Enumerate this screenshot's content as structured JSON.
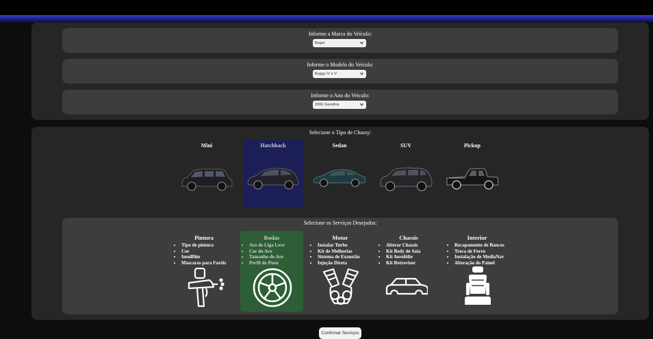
{
  "vehicle": {
    "brand": {
      "label": "Informe a Marca do Veículo:",
      "value": "Bugre"
    },
    "model": {
      "label": "Informe o Modelo do Veículo:",
      "value": "Buggy IV e V"
    },
    "year": {
      "label": "Informe o Ano do Veículo:",
      "value": "2006 Gasolina"
    }
  },
  "chassis": {
    "title": "Selecione o Tipo de Chassy:",
    "selected": "Hatchback",
    "types": [
      {
        "name": "Mini",
        "icon": "mini-car-icon"
      },
      {
        "name": "Hatchback",
        "icon": "hatchback-car-icon"
      },
      {
        "name": "Sedan",
        "icon": "sedan-car-icon"
      },
      {
        "name": "SUV",
        "icon": "suv-car-icon"
      },
      {
        "name": "Pickup",
        "icon": "pickup-truck-icon"
      }
    ]
  },
  "services": {
    "title": "Selecione os Serviços Desejados:",
    "selected": "Rodas",
    "groups": [
      {
        "name": "Pintura",
        "icon": "spray-gun-icon",
        "items": [
          "Tipo de pintura",
          "Cor",
          "Insulfilm",
          "Mascaras para Faróis"
        ]
      },
      {
        "name": "Rodas",
        "icon": "wheel-icon",
        "items": [
          "Aro de Liga Leve",
          "Cor do Aro",
          "Tamanho do Aro",
          "Perfil do Pneu"
        ]
      },
      {
        "name": "Motor",
        "icon": "engine-icon",
        "items": [
          "Instalar Turbo",
          "Kit de Melhorias",
          "Sistema de Exaustão",
          "Injeção Direta"
        ]
      },
      {
        "name": "Chassis",
        "icon": "car-outline-icon",
        "items": [
          "Alterar Chassis",
          "Kit Body de Saia",
          "Kit Aerofólio",
          "Kit Retrovisor"
        ]
      },
      {
        "name": "Interior",
        "icon": "car-seat-icon",
        "items": [
          "Recapamento de Bancos",
          "Troca de Forro",
          "Instalação de MediaNav",
          "Alteração do Painel"
        ]
      }
    ]
  },
  "confirm_label": "Confirmar Serviços",
  "colors": {
    "selected_chassis": "#1c1e57",
    "selected_service": "#2e5e36",
    "header_band": "#3b3bd6"
  }
}
